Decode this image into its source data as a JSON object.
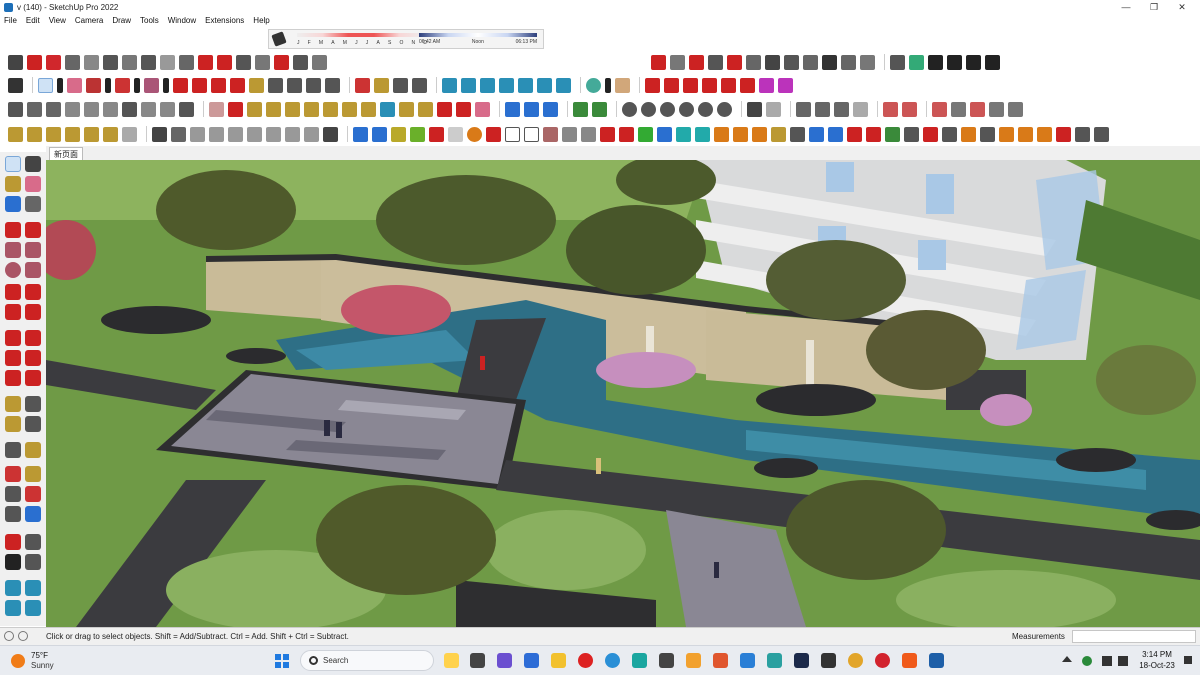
{
  "window": {
    "title": "v (140) - SketchUp Pro 2022",
    "controls": [
      "minimize",
      "maximize",
      "close"
    ]
  },
  "menu": [
    "File",
    "Edit",
    "View",
    "Camera",
    "Draw",
    "Tools",
    "Window",
    "Extensions",
    "Help"
  ],
  "shadow_settings": {
    "months": [
      "J",
      "F",
      "M",
      "A",
      "M",
      "J",
      "J",
      "A",
      "S",
      "O",
      "N",
      "D"
    ],
    "sunrise": "06:42 AM",
    "noon": "Noon",
    "sunset": "06:13 PM"
  },
  "scene_tabs": [
    "新页面"
  ],
  "status": {
    "message": "Click or drag to select objects. Shift = Add/Subtract. Ctrl = Add. Shift + Ctrl = Subtract.",
    "measurements_label": "Measurements",
    "measurements_value": ""
  },
  "taskbar": {
    "weather_temp": "75°F",
    "weather_condition": "Sunny",
    "search_placeholder": "Search",
    "time": "3:14 PM",
    "date": "18-Oct-23"
  },
  "colors": {
    "grass": "#6f9a46",
    "water": "#2e6f86",
    "plaza": "#8a8794",
    "paving_dark": "#3b3b3f",
    "wall": "#c9bb98",
    "building": "#d9dadb",
    "accent_red": "#d0272c",
    "taskbar": "#e9ecf1"
  }
}
